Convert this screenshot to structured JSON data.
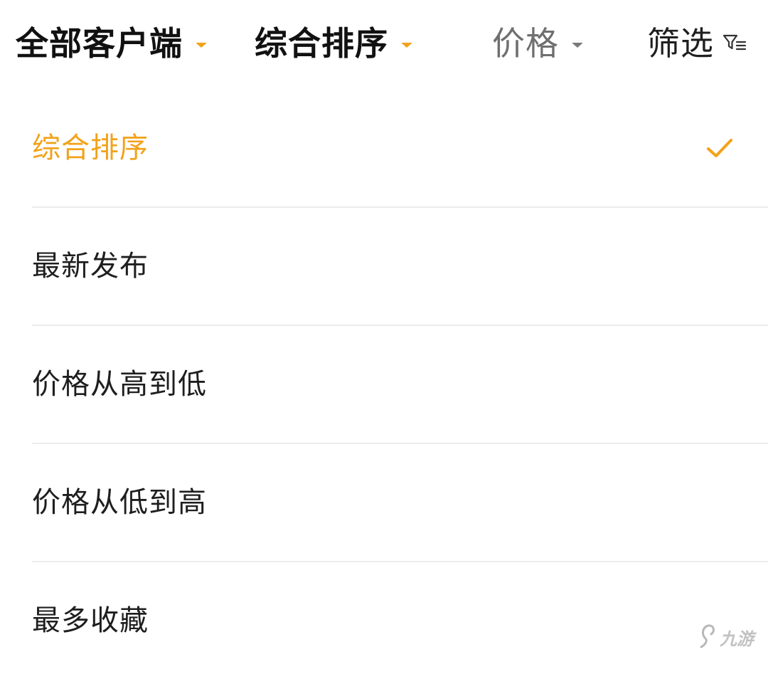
{
  "filter_bar": {
    "tabs": [
      {
        "label": "全部客户端",
        "caret": "caret-down-icon",
        "caret_color": "#f2a21b"
      },
      {
        "label": "综合排序",
        "caret": "caret-down-icon",
        "caret_color": "#f2a21b"
      },
      {
        "label": "价格",
        "caret": "caret-down-icon",
        "caret_color": "#7a7a7a"
      },
      {
        "label": "筛选",
        "icon": "filter-icon"
      }
    ]
  },
  "sort_menu": {
    "options": [
      {
        "label": "综合排序",
        "selected": true
      },
      {
        "label": "最新发布",
        "selected": false
      },
      {
        "label": "价格从高到低",
        "selected": false
      },
      {
        "label": "价格从低到高",
        "selected": false
      },
      {
        "label": "最多收藏",
        "selected": false
      }
    ],
    "selected_icon": "check-icon"
  },
  "watermark": {
    "text": "九游"
  },
  "colors": {
    "accent": "#f2a21b",
    "text_primary": "#1e1e1e",
    "text_muted": "#6f6f6f",
    "divider": "#ececec",
    "background": "#ffffff"
  }
}
